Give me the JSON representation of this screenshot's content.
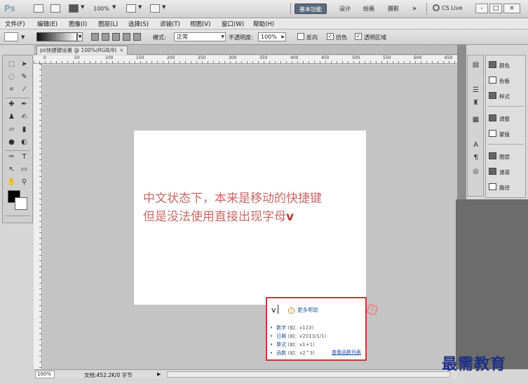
{
  "titlebar": {
    "app_logo": "Ps",
    "zoom": "100%",
    "workspaces": [
      "基本功能",
      "设计",
      "绘画",
      "摄影"
    ],
    "more": "»",
    "cslive": "CS Live",
    "window_controls": [
      "-",
      "□",
      "×"
    ]
  },
  "menu": [
    "文件(F)",
    "编辑(E)",
    "图像(I)",
    "图层(L)",
    "选择(S)",
    "滤镜(T)",
    "视图(V)",
    "窗口(W)",
    "帮助(H)"
  ],
  "options": {
    "mode_label": "模式:",
    "mode_value": "正常",
    "opacity_label": "不透明度:",
    "opacity_value": "100%",
    "reverse_label": "反向",
    "dither_label": "仿色",
    "transparency_label": "透明区域"
  },
  "document": {
    "tab_title": "ps快捷键设置 @ 100%(RGB/8)",
    "tab_close": "×",
    "canvas_line1": "中文状态下，本来是移动的快捷键",
    "canvas_line2_prefix": "但是没法使用直接出现字母",
    "canvas_line2_letter": "v"
  },
  "ruler": {
    "labels": [
      "0",
      "50",
      "100",
      "150",
      "200",
      "250",
      "300",
      "350",
      "400",
      "450",
      "500",
      "550",
      "600",
      "650"
    ]
  },
  "ime": {
    "typed": "v",
    "help_icon": "!",
    "help_link": "更多帮助",
    "options": [
      {
        "label": "数字",
        "hint": "(如：v123)"
      },
      {
        "label": "日期",
        "hint": "(如：v2013/1/1)"
      },
      {
        "label": "算式",
        "hint": "(如：v1+1)"
      },
      {
        "label": "函数",
        "hint": "(如：v2^3)"
      }
    ],
    "more_link": "查看函数列表",
    "logo": "S"
  },
  "panels": {
    "group1": [
      "颜色",
      "色板",
      "样式"
    ],
    "group2": [
      "调整",
      "蒙版"
    ],
    "group3": [
      "图层",
      "通道",
      "路径"
    ]
  },
  "status": {
    "zoom": "100%",
    "doc_info": "文档:452.2K/0 字节",
    "arrow": "▶"
  },
  "watermark": "最需教育"
}
